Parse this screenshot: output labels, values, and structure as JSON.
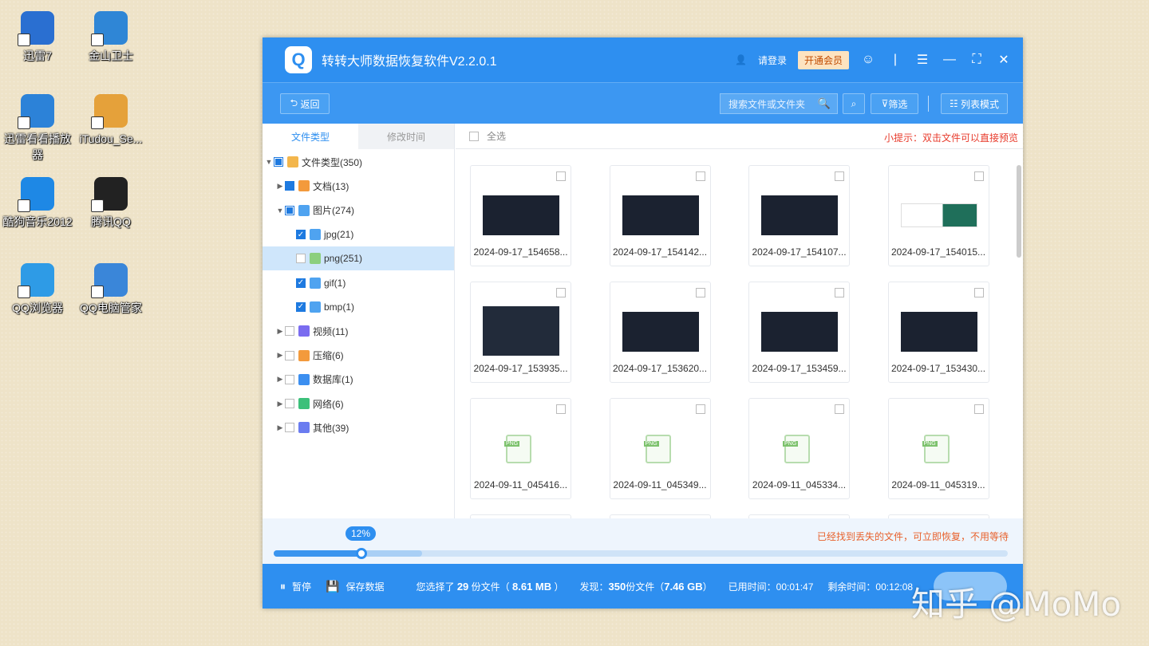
{
  "desktop": {
    "icons": [
      {
        "label": "迅雷7",
        "color": "#2a6fd1"
      },
      {
        "label": "金山卫士",
        "color": "#2f86d6"
      },
      {
        "label": "迅雷看看播放器",
        "color": "#2c82d8"
      },
      {
        "label": "iTudou_Se...",
        "color": "#e5a13a"
      },
      {
        "label": "酷狗音乐2012",
        "color": "#1e88e5"
      },
      {
        "label": "腾讯QQ",
        "color": "#222222"
      },
      {
        "label": "QQ浏览器",
        "color": "#2e9be6"
      },
      {
        "label": "QQ电脑管家",
        "color": "#3a86d9"
      }
    ]
  },
  "app": {
    "title": "转转大师数据恢复软件V2.2.0.1",
    "login": "请登录",
    "vip": "开通会员",
    "back": "返回",
    "search_placeholder": "搜索文件或文件夹",
    "filter": "筛选",
    "view_mode": "列表模式"
  },
  "left": {
    "tabs": [
      "文件类型",
      "修改时间"
    ],
    "tree": [
      {
        "label": "文件类型(350)",
        "arrow": "▼",
        "check": "part",
        "color": "#f3b64c"
      },
      {
        "label": "文档(13)",
        "arrow": "▶",
        "check": "full",
        "color": "#f39a3c"
      },
      {
        "label": "图片(274)",
        "arrow": "▼",
        "check": "part",
        "color": "#4fa3f0"
      },
      {
        "label": "jpg(21)",
        "arrow": "",
        "check": "full",
        "color": "#4fa3f0"
      },
      {
        "label": "png(251)",
        "arrow": "",
        "check": "none",
        "color": "#8ccf7e"
      },
      {
        "label": "gif(1)",
        "arrow": "",
        "check": "full",
        "color": "#4fa3f0"
      },
      {
        "label": "bmp(1)",
        "arrow": "",
        "check": "full",
        "color": "#4fa3f0"
      },
      {
        "label": "视频(11)",
        "arrow": "▶",
        "check": "none",
        "color": "#7a6cf0"
      },
      {
        "label": "压缩(6)",
        "arrow": "▶",
        "check": "none",
        "color": "#f39a3c"
      },
      {
        "label": "数据库(1)",
        "arrow": "▶",
        "check": "none",
        "color": "#3c8ff0"
      },
      {
        "label": "网络(6)",
        "arrow": "▶",
        "check": "none",
        "color": "#3cc07a"
      },
      {
        "label": "其他(39)",
        "arrow": "▶",
        "check": "none",
        "color": "#6a7cf0"
      }
    ]
  },
  "right": {
    "select_all": "全选",
    "tip": "小提示：双击文件可以直接预览",
    "files": [
      {
        "name": "2024-09-17_154658...",
        "kind": "dark"
      },
      {
        "name": "2024-09-17_154142...",
        "kind": "dark"
      },
      {
        "name": "2024-09-17_154107...",
        "kind": "dark"
      },
      {
        "name": "2024-09-17_154015...",
        "kind": "light"
      },
      {
        "name": "2024-09-17_153935...",
        "kind": "dark"
      },
      {
        "name": "2024-09-17_153620...",
        "kind": "dark"
      },
      {
        "name": "2024-09-17_153459...",
        "kind": "dark"
      },
      {
        "name": "2024-09-17_153430...",
        "kind": "dark"
      },
      {
        "name": "2024-09-11_045416...",
        "kind": "png"
      },
      {
        "name": "2024-09-11_045349...",
        "kind": "png"
      },
      {
        "name": "2024-09-11_045334...",
        "kind": "png"
      },
      {
        "name": "2024-09-11_045319...",
        "kind": "png"
      }
    ],
    "png_badge": "PNG"
  },
  "progress": {
    "percent_label": "12%",
    "percent": 12,
    "message": "已经找到丢失的文件，可立即恢复，不用等待"
  },
  "status": {
    "pause": "暂停",
    "save": "保存数据",
    "selected_prefix": "您选择了",
    "selected_count": "29",
    "selected_mid": "份文件（",
    "selected_size": "8.61 MB",
    "selected_suffix": "）",
    "found_prefix": "发现：",
    "found_count": "350",
    "found_mid": "份文件（",
    "found_size": "7.46 GB",
    "found_suffix": "）",
    "elapsed": "已用时间：00:01:47",
    "remaining": "剩余时间：00:12:08"
  },
  "watermark": "知乎 @MoMo"
}
